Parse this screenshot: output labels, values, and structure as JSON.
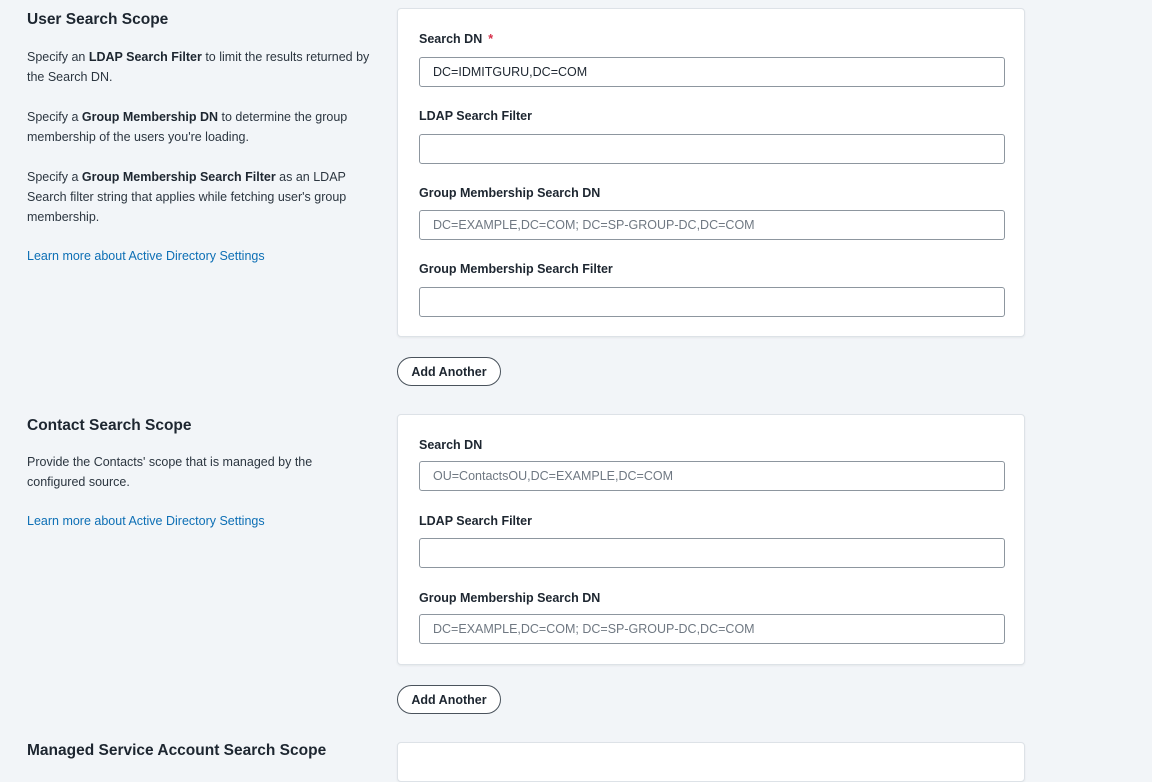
{
  "user_scope": {
    "title": "User Search Scope",
    "desc1": {
      "pre": "Specify an ",
      "bold": "LDAP Search Filter",
      "post": " to limit the results returned by the Search DN."
    },
    "desc2": {
      "pre": "Specify a ",
      "bold": "Group Membership DN",
      "post": " to determine the group membership of the users you're loading."
    },
    "desc3": {
      "pre": "Specify a ",
      "bold": "Group Membership Search Filter",
      "post": " as an LDAP Search filter string that applies while fetching user's group membership."
    },
    "learn_more": "Learn more about Active Directory Settings",
    "fields": {
      "search_dn": {
        "label": "Search DN",
        "required_mark": "*",
        "value": "DC=IDMITGURU,DC=COM",
        "placeholder": ""
      },
      "ldap_filter": {
        "label": "LDAP Search Filter",
        "value": "",
        "placeholder": ""
      },
      "group_dn": {
        "label": "Group Membership Search DN",
        "value": "",
        "placeholder": "DC=EXAMPLE,DC=COM; DC=SP-GROUP-DC,DC=COM"
      },
      "group_filter": {
        "label": "Group Membership Search Filter",
        "value": "",
        "placeholder": ""
      }
    },
    "add_another": "Add Another"
  },
  "contact_scope": {
    "title": "Contact Search Scope",
    "desc": "Provide the Contacts' scope that is managed by the configured source.",
    "learn_more": "Learn more about Active Directory Settings",
    "fields": {
      "search_dn": {
        "label": "Search DN",
        "value": "",
        "placeholder": "OU=ContactsOU,DC=EXAMPLE,DC=COM"
      },
      "ldap_filter": {
        "label": "LDAP Search Filter",
        "value": "",
        "placeholder": ""
      },
      "group_dn": {
        "label": "Group Membership Search DN",
        "value": "",
        "placeholder": "DC=EXAMPLE,DC=COM; DC=SP-GROUP-DC,DC=COM"
      }
    },
    "add_another": "Add Another"
  },
  "managed_scope": {
    "title": "Managed Service Account Search Scope"
  }
}
